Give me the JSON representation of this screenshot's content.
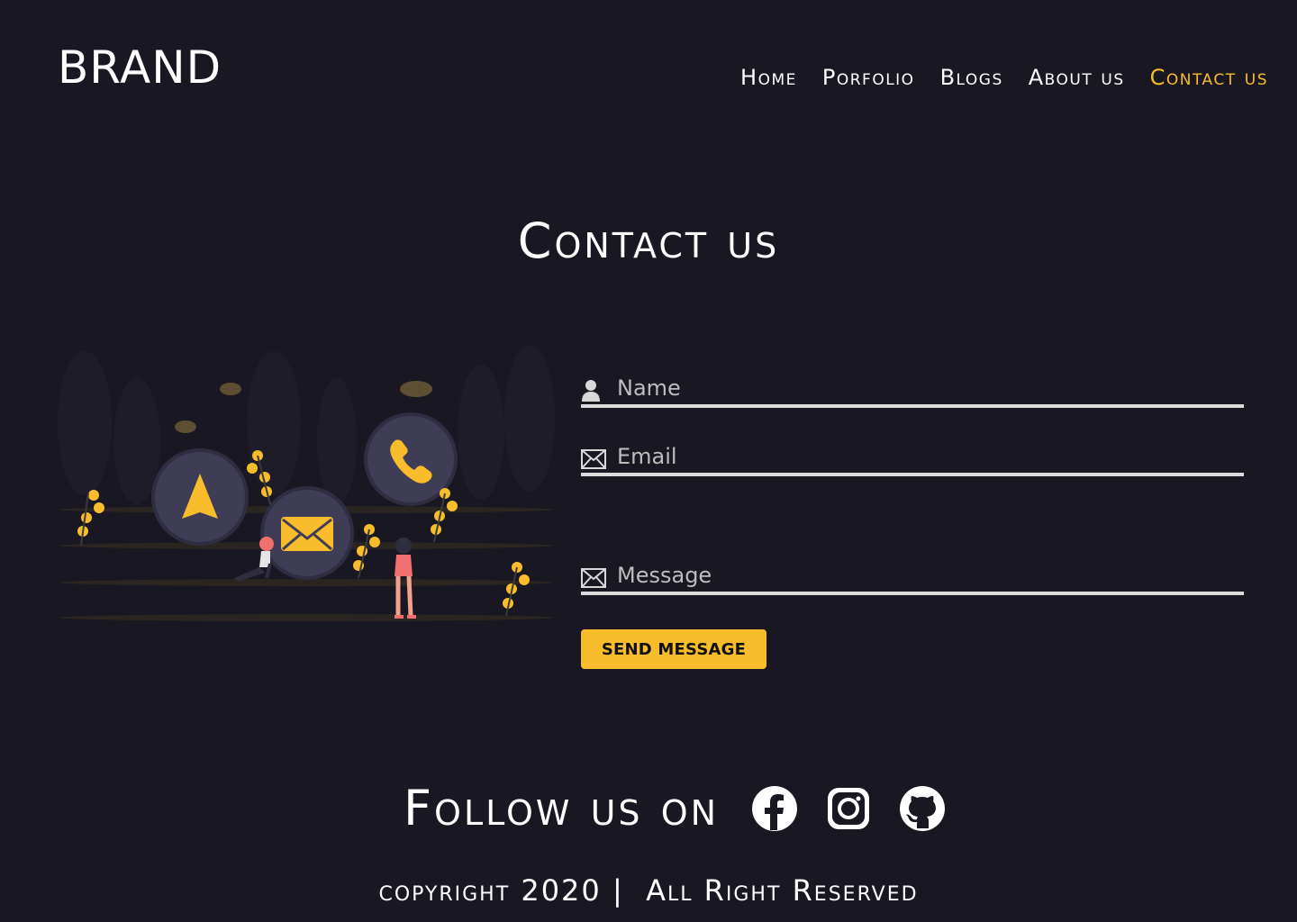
{
  "header": {
    "brand": "BRAND",
    "nav": [
      {
        "label": "Home"
      },
      {
        "label": "Porfolio"
      },
      {
        "label": "Blogs"
      },
      {
        "label": "About us"
      },
      {
        "label": "Contact us",
        "active": true
      }
    ]
  },
  "main": {
    "title": "Contact us",
    "form": {
      "name_placeholder": "Name",
      "email_placeholder": "Email",
      "message_placeholder": "Message",
      "send_label": "SEND MESSAGE"
    }
  },
  "footer": {
    "follow_label": "Follow us on",
    "social": [
      "facebook-icon",
      "instagram-icon",
      "github-icon"
    ],
    "copyright": "copyright 2020 |  All Right Reserved"
  },
  "colors": {
    "background": "#181722",
    "accent": "#f9bd2c",
    "text": "#ffffff",
    "input_underline": "#dcdcdc",
    "illustration_circle": "#3f3d56"
  }
}
